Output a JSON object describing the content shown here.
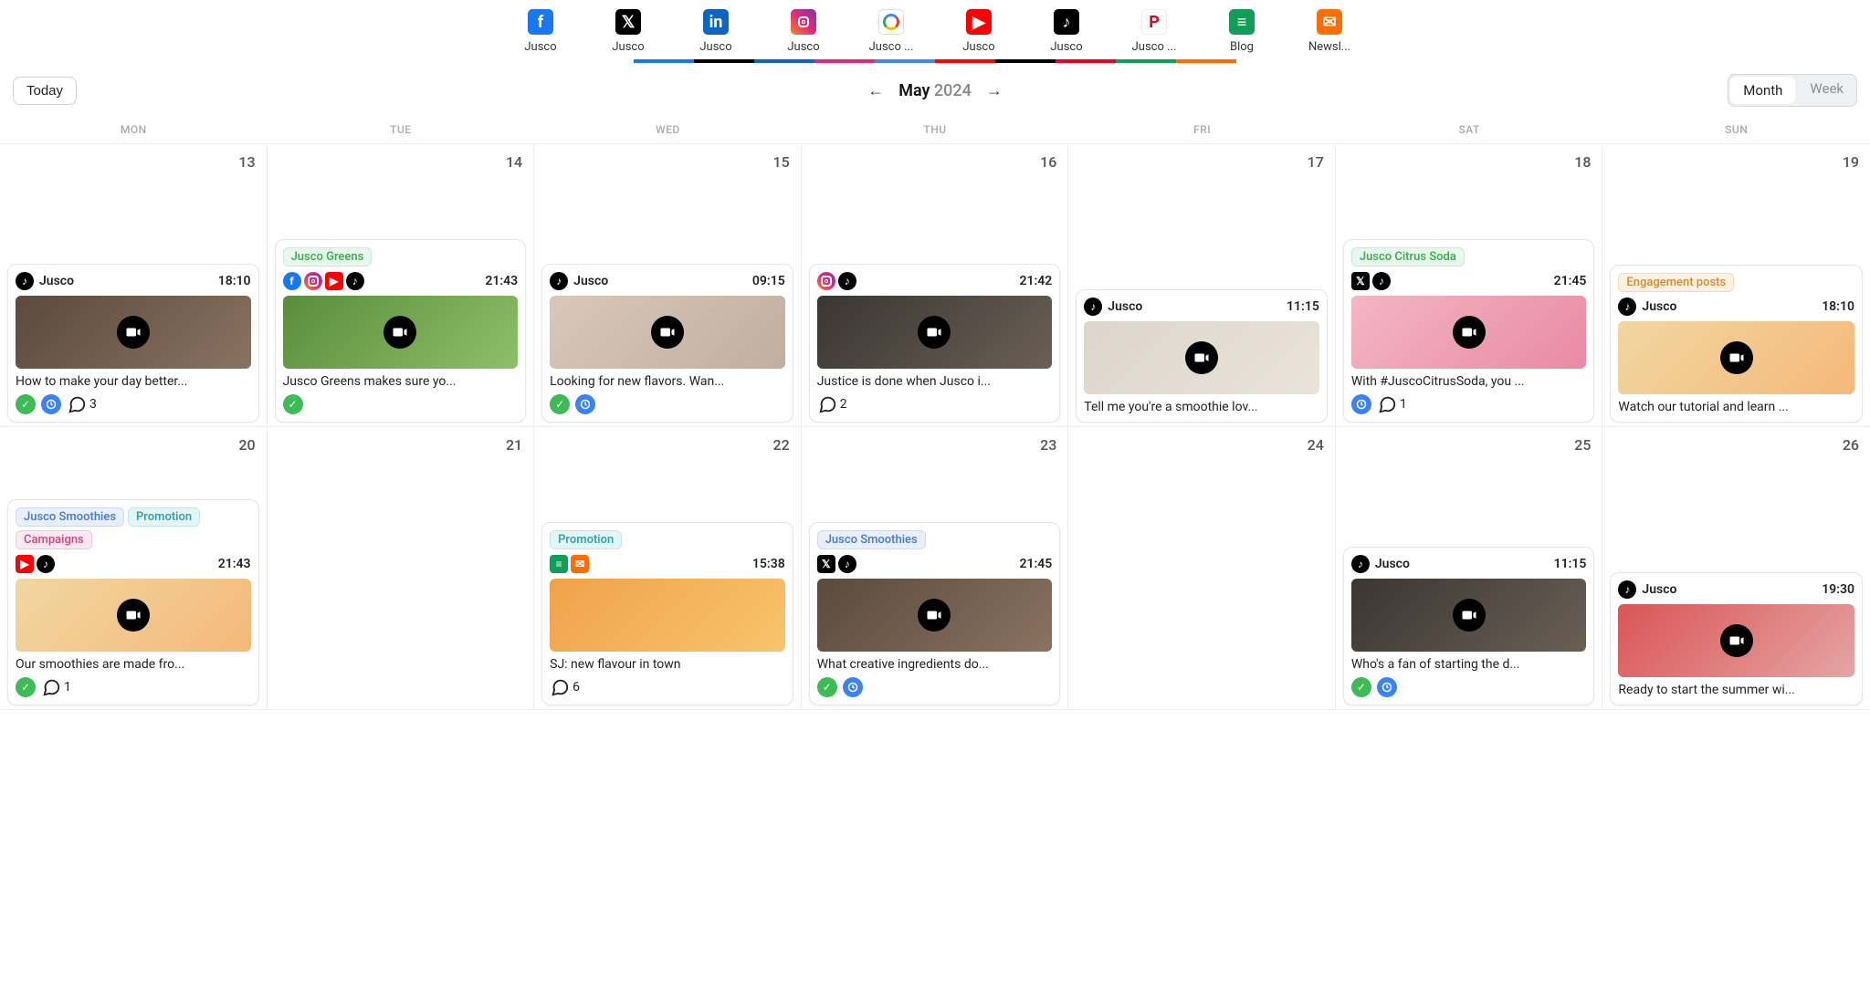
{
  "channels": [
    {
      "label": "Jusco",
      "icon": "facebook",
      "underline": "#1877f2"
    },
    {
      "label": "Jusco",
      "icon": "x",
      "underline": "#000"
    },
    {
      "label": "Jusco",
      "icon": "linkedin",
      "underline": "#0a66c2"
    },
    {
      "label": "Jusco",
      "icon": "instagram",
      "underline": "#dd2a7b"
    },
    {
      "label": "Jusco ...",
      "icon": "google",
      "underline": "#4285f4"
    },
    {
      "label": "Jusco",
      "icon": "youtube",
      "underline": "#ff0000"
    },
    {
      "label": "Jusco",
      "icon": "tiktok",
      "underline": "#000"
    },
    {
      "label": "Jusco ...",
      "icon": "pinterest",
      "underline": "#e60023"
    },
    {
      "label": "Blog",
      "icon": "gdoc",
      "underline": "#0f9d58"
    },
    {
      "label": "Newsl...",
      "icon": "mail",
      "underline": "#ff6d00"
    }
  ],
  "toolbar": {
    "today": "Today",
    "month": "May",
    "year": "2024",
    "view_month": "Month",
    "view_week": "Week",
    "active_view": "Month"
  },
  "dow": [
    "MON",
    "TUE",
    "WED",
    "THU",
    "FRI",
    "SAT",
    "SUN"
  ],
  "days": [
    {
      "num": "13",
      "post": {
        "account": "Jusco",
        "icons": [
          "tiktok"
        ],
        "time": "18:10",
        "thumb": "brownbg",
        "caption": "How to make your day better...",
        "check": true,
        "clock": true,
        "comments": "3"
      }
    },
    {
      "num": "14",
      "post": {
        "tags": [
          {
            "label": "Jusco Greens",
            "style": "tag-green"
          }
        ],
        "icons_row": [
          "facebook",
          "instagram",
          "youtube",
          "tiktok"
        ],
        "time": "21:43",
        "thumb": "greenbg",
        "caption": "Jusco Greens makes sure yo...",
        "check": true
      }
    },
    {
      "num": "15",
      "post": {
        "account": "Jusco",
        "icons": [
          "tiktok"
        ],
        "time": "09:15",
        "thumb": "facebg",
        "caption": "Looking for new flavors. Wan...",
        "check": true,
        "clock": true
      }
    },
    {
      "num": "16",
      "post": {
        "icons": [
          "instagram",
          "tiktok"
        ],
        "time": "21:42",
        "thumb": "darkbg",
        "caption": "Justice is done when Jusco i...",
        "comments": "2"
      }
    },
    {
      "num": "17",
      "post": {
        "account": "Jusco",
        "icons": [
          "tiktok"
        ],
        "time": "11:15",
        "thumb": "smoothiebg",
        "caption": "Tell me you're a smoothie lov..."
      }
    },
    {
      "num": "18",
      "post": {
        "tags": [
          {
            "label": "Jusco Citrus Soda",
            "style": "tag-green"
          }
        ],
        "icons_row": [
          "x",
          "tiktok"
        ],
        "time": "21:45",
        "thumb": "pinkbg",
        "caption": "With #JuscoCitrusSoda, you ...",
        "clock": true,
        "comments": "1"
      }
    },
    {
      "num": "19",
      "post": {
        "tags": [
          {
            "label": "Engagement posts",
            "style": "tag-orange"
          }
        ],
        "account": "Jusco",
        "icons": [
          "tiktok"
        ],
        "time": "18:10",
        "thumb": "fruitbg",
        "caption": "Watch our tutorial and learn ..."
      }
    },
    {
      "num": "20",
      "post": {
        "tags": [
          {
            "label": "Jusco Smoothies",
            "style": "tag-blue"
          },
          {
            "label": "Promotion",
            "style": "tag-teal"
          },
          {
            "label": "Campaigns",
            "style": "tag-pink"
          }
        ],
        "icons_row": [
          "youtube",
          "tiktok"
        ],
        "time": "21:43",
        "thumb": "fruitbg",
        "caption": "Our smoothies are made fro...",
        "check": true,
        "comments": "1"
      }
    },
    {
      "num": "21"
    },
    {
      "num": "22",
      "post": {
        "tags": [
          {
            "label": "Promotion",
            "style": "tag-teal"
          }
        ],
        "icons_row": [
          "gdoc",
          "mail"
        ],
        "time": "15:38",
        "thumb": "orangebg",
        "caption": "SJ: new flavour in town",
        "comments": "6",
        "no_video": true
      }
    },
    {
      "num": "23",
      "post": {
        "tags": [
          {
            "label": "Jusco Smoothies",
            "style": "tag-blue"
          }
        ],
        "icons_row": [
          "x",
          "tiktok"
        ],
        "time": "21:45",
        "thumb": "brownbg",
        "caption": "What creative ingredients do...",
        "check": true,
        "clock": true
      }
    },
    {
      "num": "24"
    },
    {
      "num": "25",
      "post": {
        "account": "Jusco",
        "icons": [
          "tiktok"
        ],
        "time": "11:15",
        "thumb": "darkbg",
        "caption": "Who's a fan of starting the d...",
        "check": true,
        "clock": true
      }
    },
    {
      "num": "26",
      "post": {
        "account": "Jusco",
        "icons": [
          "tiktok"
        ],
        "time": "19:30",
        "thumb": "redbg",
        "caption": "Ready to start the summer wi..."
      }
    }
  ]
}
